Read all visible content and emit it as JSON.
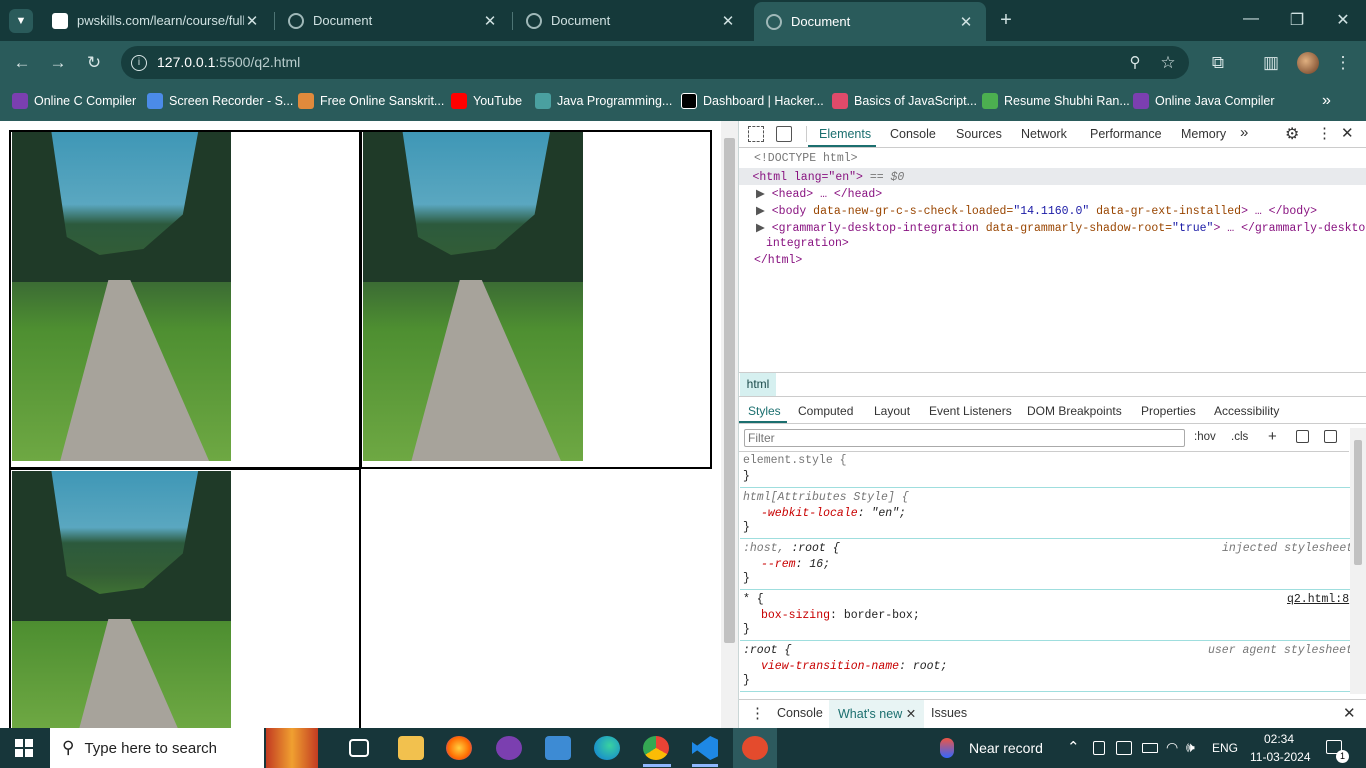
{
  "browser": {
    "tabs": [
      {
        "title": "pwskills.com/learn/course/full-s"
      },
      {
        "title": "Document"
      },
      {
        "title": "Document"
      },
      {
        "title": "Document",
        "active": true
      }
    ],
    "url_host": "127.0.0.1",
    "url_rest": ":5500/q2.html",
    "bookmarks": [
      "Online C Compiler",
      "Screen Recorder - S...",
      "Free Online Sanskrit...",
      "YouTube",
      "Java Programming...",
      "Dashboard | Hacker...",
      "Basics of JavaScript...",
      "Resume Shubhi Ran...",
      "Online Java Compiler"
    ]
  },
  "devtools": {
    "tabs": [
      "Elements",
      "Console",
      "Sources",
      "Network",
      "Performance",
      "Memory"
    ],
    "dom": {
      "doctype": "<!DOCTYPE html>",
      "html_open": "<html lang=\"en\">",
      "html_sel": "== $0",
      "head": "<head> … </head>",
      "body_tag": "<body",
      "body_attr1": " data-new-gr-c-s-check-loaded=",
      "body_val1": "\"14.1160.0\"",
      "body_attr2": " data-gr-ext-installed",
      "body_close": "> … </body>",
      "gram_tag": "<grammarly-desktop-integration",
      "gram_attr": " data-grammarly-shadow-root=",
      "gram_val": "\"true\"",
      "gram_close": "> … </grammarly-desktop-",
      "gram_close2": "integration>",
      "html_close": "</html>"
    },
    "breadcrumb": "html",
    "sub_tabs": [
      "Styles",
      "Computed",
      "Layout",
      "Event Listeners",
      "DOM Breakpoints",
      "Properties",
      "Accessibility"
    ],
    "filter_placeholder": "Filter",
    "hov": ":hov",
    "cls": ".cls",
    "styles": {
      "r1_sel": "element.style {",
      "close": "}",
      "r2_sel": "html[Attributes Style] {",
      "r2_prop": "-webkit-locale",
      "r2_val": ": \"en\";",
      "r3_sel_a": ":host, ",
      "r3_sel_b": ":root {",
      "r3_src": "injected stylesheet",
      "r3_prop": "--rem",
      "r3_val": ": 16;",
      "r4_sel": "* {",
      "r4_src": "q2.html:8",
      "r4_prop": "box-sizing",
      "r4_val": ": border-box;",
      "r5_sel": ":root {",
      "r5_src": "user agent stylesheet",
      "r5_prop": "view-transition-name",
      "r5_val": ": root;"
    },
    "drawer": [
      "Console",
      "What's new",
      "Issues"
    ]
  },
  "taskbar": {
    "search_text": "Type here to search",
    "weather": "Near record",
    "lang": "ENG",
    "time": "02:34",
    "date": "11-03-2024",
    "notif_count": "1"
  }
}
